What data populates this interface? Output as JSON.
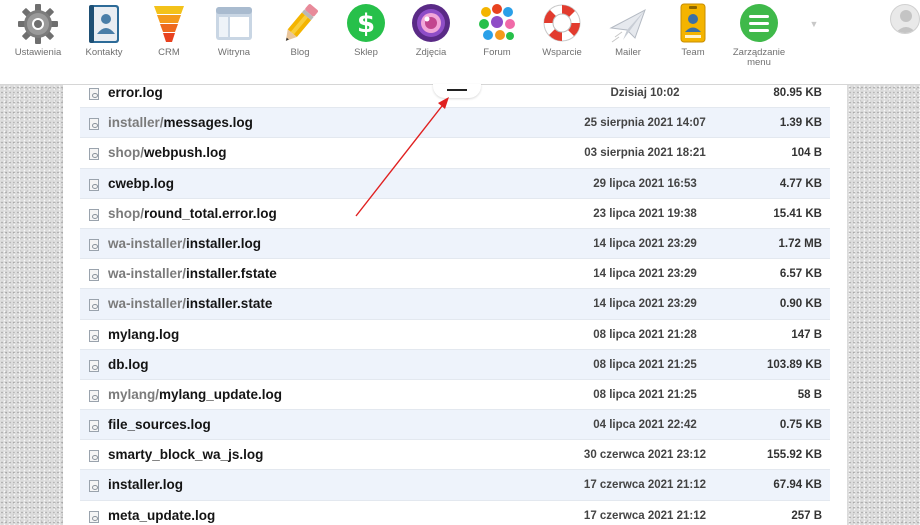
{
  "apps": [
    {
      "id": "ustawienia",
      "label": "Ustawienia",
      "icon": "gear-icon"
    },
    {
      "id": "kontakty",
      "label": "Kontakty",
      "icon": "contacts-book-icon"
    },
    {
      "id": "crm",
      "label": "CRM",
      "icon": "funnel-icon"
    },
    {
      "id": "witryna",
      "label": "Witryna",
      "icon": "site-window-icon"
    },
    {
      "id": "blog",
      "label": "Blog",
      "icon": "pencil-icon"
    },
    {
      "id": "sklep",
      "label": "Sklep",
      "icon": "dollar-shop-icon"
    },
    {
      "id": "zdjecia",
      "label": "Zdjęcia",
      "icon": "camera-lens-icon"
    },
    {
      "id": "forum",
      "label": "Forum",
      "icon": "colorful-bubbles-icon"
    },
    {
      "id": "wsparcie",
      "label": "Wsparcie",
      "icon": "lifebuoy-icon"
    },
    {
      "id": "mailer",
      "label": "Mailer",
      "icon": "paper-plane-icon"
    },
    {
      "id": "team",
      "label": "Team",
      "icon": "team-badge-icon"
    },
    {
      "id": "zarzadzanie",
      "label": "Zarządzanie",
      "label2": "menu",
      "icon": "menu-lines-icon"
    }
  ],
  "files": [
    {
      "dir": "",
      "name": "error.log",
      "date": "Dzisiaj 10:02",
      "size": "80.95 KB"
    },
    {
      "dir": "installer/",
      "name": "messages.log",
      "date": "25 sierpnia 2021 14:07",
      "size": "1.39 KB"
    },
    {
      "dir": "shop/",
      "name": "webpush.log",
      "date": "03 sierpnia 2021 18:21",
      "size": "104 B"
    },
    {
      "dir": "",
      "name": "cwebp.log",
      "date": "29 lipca 2021 16:53",
      "size": "4.77 KB"
    },
    {
      "dir": "shop/",
      "name": "round_total.error.log",
      "date": "23 lipca 2021 19:38",
      "size": "15.41 KB"
    },
    {
      "dir": "wa-installer/",
      "name": "installer.log",
      "date": "14 lipca 2021 23:29",
      "size": "1.72 MB"
    },
    {
      "dir": "wa-installer/",
      "name": "installer.fstate",
      "date": "14 lipca 2021 23:29",
      "size": "6.57 KB"
    },
    {
      "dir": "wa-installer/",
      "name": "installer.state",
      "date": "14 lipca 2021 23:29",
      "size": "0.90 KB"
    },
    {
      "dir": "",
      "name": "mylang.log",
      "date": "08 lipca 2021 21:28",
      "size": "147 B"
    },
    {
      "dir": "",
      "name": "db.log",
      "date": "08 lipca 2021 21:25",
      "size": "103.89 KB"
    },
    {
      "dir": "mylang/",
      "name": "mylang_update.log",
      "date": "08 lipca 2021 21:25",
      "size": "58 B"
    },
    {
      "dir": "",
      "name": "file_sources.log",
      "date": "04 lipca 2021 22:42",
      "size": "0.75 KB"
    },
    {
      "dir": "",
      "name": "smarty_block_wa_js.log",
      "date": "30 czerwca 2021 23:12",
      "size": "155.92 KB"
    },
    {
      "dir": "",
      "name": "installer.log",
      "date": "17 czerwca 2021 21:12",
      "size": "67.94 KB"
    },
    {
      "dir": "",
      "name": "meta_update.log",
      "date": "17 czerwca 2021 21:12",
      "size": "257 B"
    }
  ],
  "colors": {
    "row_alt": "#eef3fb",
    "dir_text": "#7b7b7b",
    "arrow": "#e02020"
  }
}
